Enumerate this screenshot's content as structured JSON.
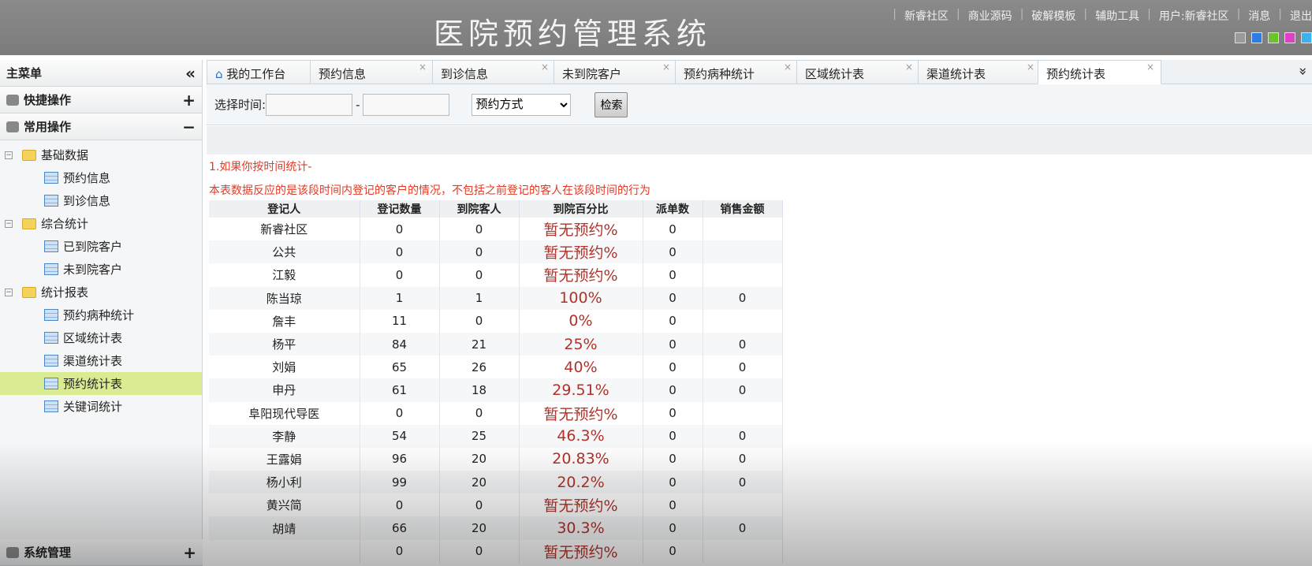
{
  "header": {
    "title": "医院预约管理系统",
    "links": [
      "新睿社区",
      "商业源码",
      "破解模板",
      "辅助工具",
      "用户:新睿社区",
      "消息",
      "退出"
    ],
    "skin_colors": [
      "#9a9a9a",
      "#2e7be6",
      "#6cc22a",
      "#e040c8",
      "#3bb1f0"
    ]
  },
  "sidebar": {
    "title": "主菜单",
    "collapse": "«",
    "sections": [
      {
        "label": "快捷操作",
        "toggle": "+"
      },
      {
        "label": "常用操作",
        "toggle": "−"
      }
    ],
    "tree": [
      {
        "folder": "基础数据",
        "items": [
          "预约信息",
          "到诊信息"
        ]
      },
      {
        "folder": "综合统计",
        "items": [
          "已到院客户",
          "未到院客户"
        ]
      },
      {
        "folder": "统计报表",
        "items": [
          "预约病种统计",
          "区域统计表",
          "渠道统计表",
          "预约统计表",
          "关键词统计"
        ]
      }
    ],
    "system": {
      "label": "系统管理",
      "toggle": "+"
    }
  },
  "tabs": [
    {
      "label": "我的工作台"
    },
    {
      "label": "预约信息"
    },
    {
      "label": "到诊信息"
    },
    {
      "label": "未到院客户"
    },
    {
      "label": "预约病种统计"
    },
    {
      "label": "区域统计表"
    },
    {
      "label": "渠道统计表"
    },
    {
      "label": "预约统计表"
    }
  ],
  "toolbar": {
    "time_label": "选择时间:",
    "dash": "-",
    "start": "",
    "end": "",
    "method": "预约方式",
    "search": "检索"
  },
  "notes": [
    "1.如果你按时间统计-",
    "本表数据反应的是该段时间内登记的客户的情况，不包括之前登记的客人在该段时间的行为"
  ],
  "table": {
    "headers": [
      "登记人",
      "登记数量",
      "到院客人",
      "到院百分比",
      "派单数",
      "销售金额"
    ],
    "rows": [
      [
        "新睿社区",
        "0",
        "0",
        "暂无预约%",
        "0",
        ""
      ],
      [
        "公共",
        "0",
        "0",
        "暂无预约%",
        "0",
        ""
      ],
      [
        "江毅",
        "0",
        "0",
        "暂无预约%",
        "0",
        ""
      ],
      [
        "陈当琼",
        "1",
        "1",
        "100%",
        "0",
        "0"
      ],
      [
        "詹丰",
        "11",
        "0",
        "0%",
        "0",
        ""
      ],
      [
        "杨平",
        "84",
        "21",
        "25%",
        "0",
        "0"
      ],
      [
        "刘娟",
        "65",
        "26",
        "40%",
        "0",
        "0"
      ],
      [
        "申丹",
        "61",
        "18",
        "29.51%",
        "0",
        "0"
      ],
      [
        "阜阳现代导医",
        "0",
        "0",
        "暂无预约%",
        "0",
        ""
      ],
      [
        "李静",
        "54",
        "25",
        "46.3%",
        "0",
        "0"
      ],
      [
        "王露娟",
        "96",
        "20",
        "20.83%",
        "0",
        "0"
      ],
      [
        "杨小利",
        "99",
        "20",
        "20.2%",
        "0",
        "0"
      ],
      [
        "黄兴简",
        "0",
        "0",
        "暂无预约%",
        "0",
        ""
      ],
      [
        "胡靖",
        "66",
        "20",
        "30.3%",
        "0",
        "0"
      ],
      [
        "",
        "0",
        "0",
        "暂无预约%",
        "0",
        ""
      ]
    ]
  }
}
